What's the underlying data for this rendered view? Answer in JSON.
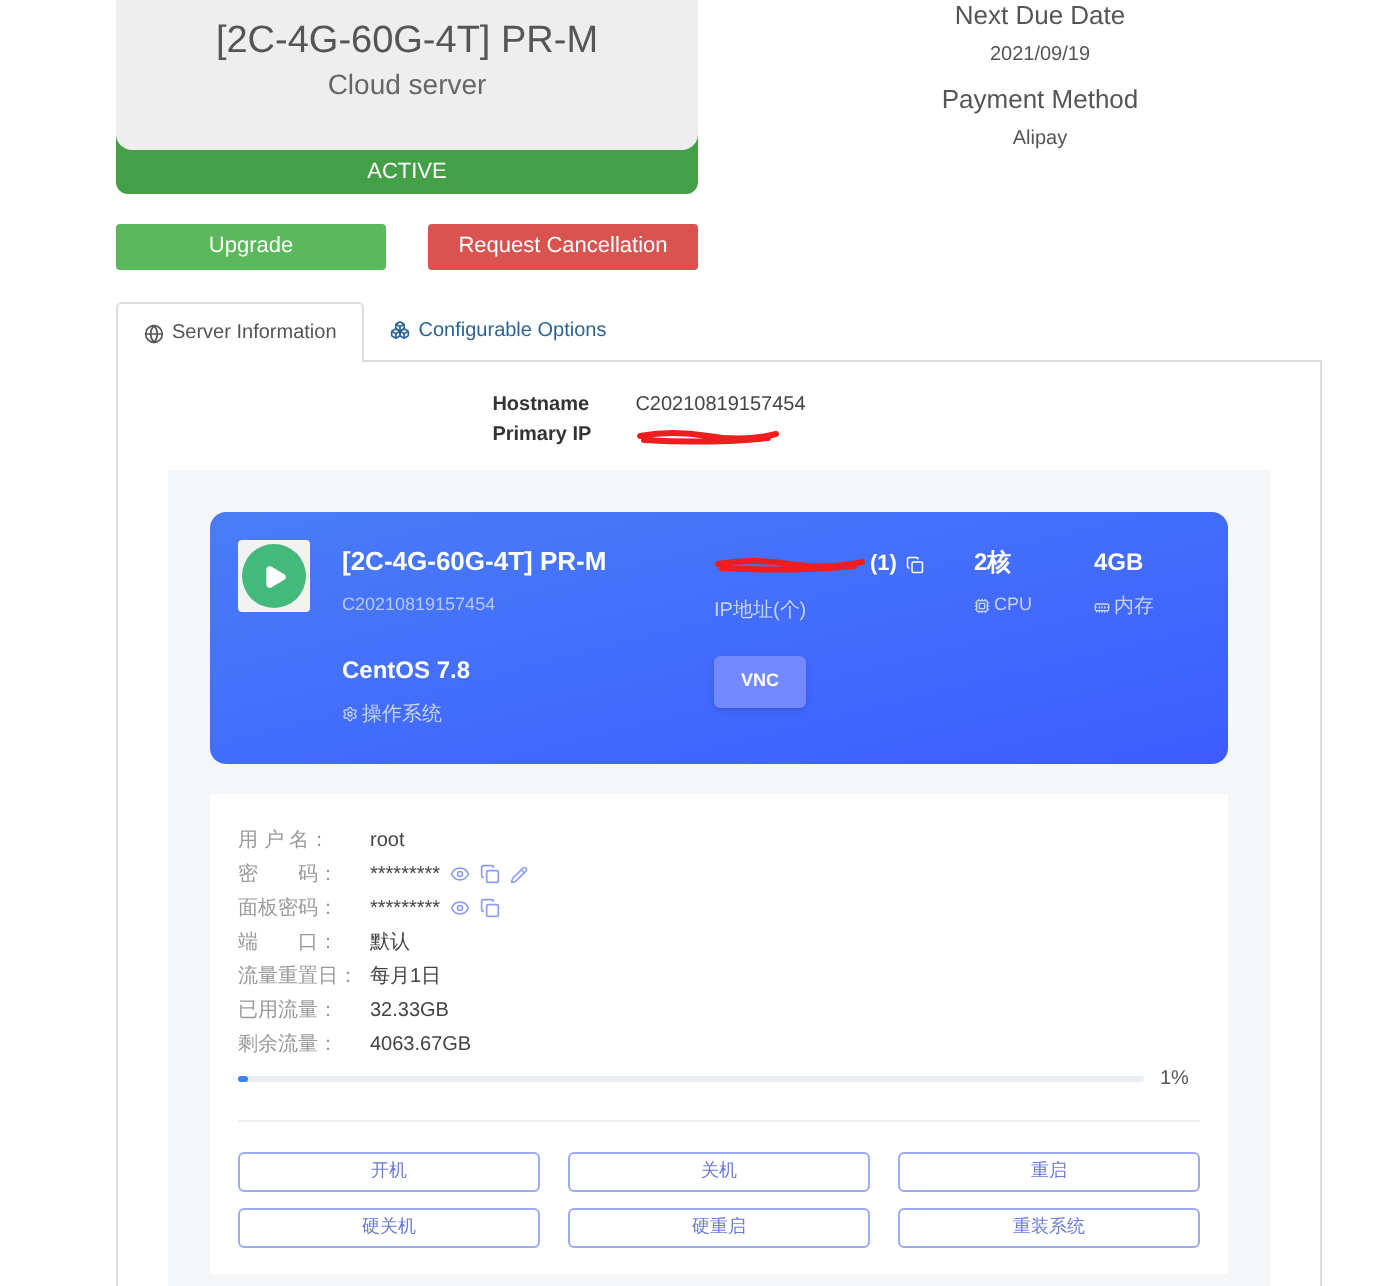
{
  "product": {
    "title": "[2C-4G-60G-4T] PR-M",
    "subtitle": "Cloud server",
    "status": "ACTIVE"
  },
  "billing": [
    {
      "label": "Next Due Date",
      "value": "2021/09/19"
    },
    {
      "label": "Payment Method",
      "value": "Alipay"
    }
  ],
  "actions": [
    {
      "label": "Upgrade",
      "kind": "primary"
    },
    {
      "label": "Request Cancellation",
      "kind": "danger"
    }
  ],
  "tabs": [
    {
      "label": "Server Information",
      "selected": true
    },
    {
      "label": "Configurable Options",
      "selected": false
    }
  ],
  "server_fields": [
    {
      "label": "Hostname",
      "kind": "text",
      "value": "C20210819157454"
    },
    {
      "label": "Primary IP",
      "kind": "redacted"
    }
  ],
  "instance": {
    "name": "[2C-4G-60G-4T] PR-M",
    "hostname": "C20210819157454",
    "running": true,
    "os": "CentOS 7.8",
    "os_label": "操作系统",
    "ip_count": "(1)",
    "ip_label": "IP地址(个)",
    "cpu": "2核",
    "cpu_label": "CPU",
    "memory": "4GB",
    "memory_label": "内存",
    "vnc": "VNC"
  },
  "details": [
    {
      "label": "用 户 名：",
      "value": "root",
      "viewable": false,
      "copyable": false,
      "editable": false
    },
    {
      "label": "密　　码：",
      "value": "*********",
      "viewable": true,
      "copyable": true,
      "editable": true
    },
    {
      "label": "面板密码：",
      "value": "*********",
      "viewable": true,
      "copyable": true,
      "editable": false
    },
    {
      "label": "端　　口：",
      "value": "默认",
      "viewable": false,
      "copyable": false,
      "editable": false
    },
    {
      "label": "流量重置日：",
      "value": "每月1日",
      "viewable": false,
      "copyable": false,
      "editable": false
    },
    {
      "label": "已用流量：",
      "value": "32.33GB",
      "viewable": false,
      "copyable": false,
      "editable": false
    },
    {
      "label": "剩余流量：",
      "value": "4063.67GB",
      "viewable": false,
      "copyable": false,
      "editable": false
    }
  ],
  "traffic": {
    "level": 0.01,
    "reading": "1%"
  },
  "power_buttons": [
    "开机",
    "关机",
    "重启",
    "硬关机",
    "硬重启",
    "重装系统"
  ]
}
